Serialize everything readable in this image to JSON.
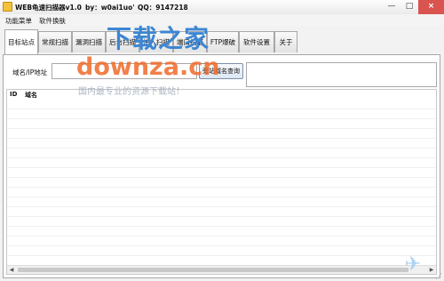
{
  "window": {
    "title": "WEB龟速扫描器v1.0",
    "author": "by：w0ai1uo'",
    "qq": "QQ：9147218",
    "controls": {
      "minimize": "—",
      "maximize": "□",
      "close": "×"
    }
  },
  "menu": [
    "功能菜单",
    "软件换肤"
  ],
  "tabs": [
    {
      "label": "目标站点",
      "active": true
    },
    {
      "label": "常规扫描"
    },
    {
      "label": "漏洞扫描"
    },
    {
      "label": "后台扫描"
    },
    {
      "label": "注入扫描"
    },
    {
      "label": "端口扫描"
    },
    {
      "label": "FTP爆破"
    },
    {
      "label": "软件设置"
    },
    {
      "label": "关于"
    }
  ],
  "target": {
    "field_label": "域名/IP地址",
    "input_value": "",
    "query_button": "旁站域名查询"
  },
  "table": {
    "columns": [
      "ID",
      "域名"
    ],
    "rows": []
  },
  "watermark": {
    "cn": "下载之家",
    "en": "downza.cn",
    "slogan": "国内最专业的资源下载站！"
  }
}
